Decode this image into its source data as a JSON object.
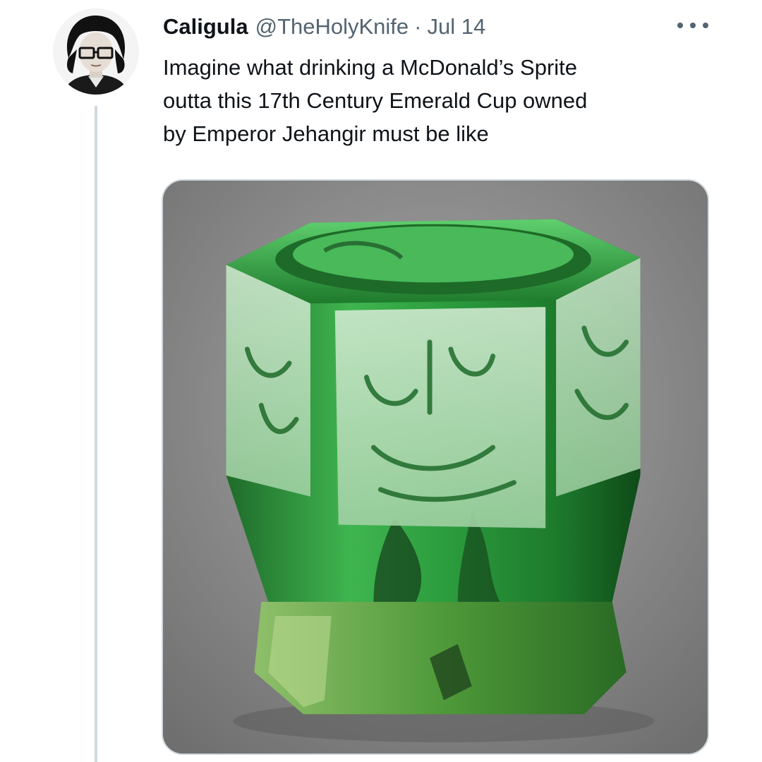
{
  "tweet": {
    "display_name": "Caligula",
    "handle": "@TheHolyKnife",
    "separator": "·",
    "date": "Jul 14",
    "text_lines": [
      "Imagine what drinking a McDonald’s Sprite",
      "outta this 17th Century Emerald Cup owned",
      "by Emperor Jehangir must be like"
    ],
    "media": {
      "icon": "emerald-cup-photo"
    }
  },
  "colors": {
    "text_primary": "#0f1419",
    "text_secondary": "#536471",
    "border": "#cfd9de",
    "emerald": "#2a9a3c"
  }
}
